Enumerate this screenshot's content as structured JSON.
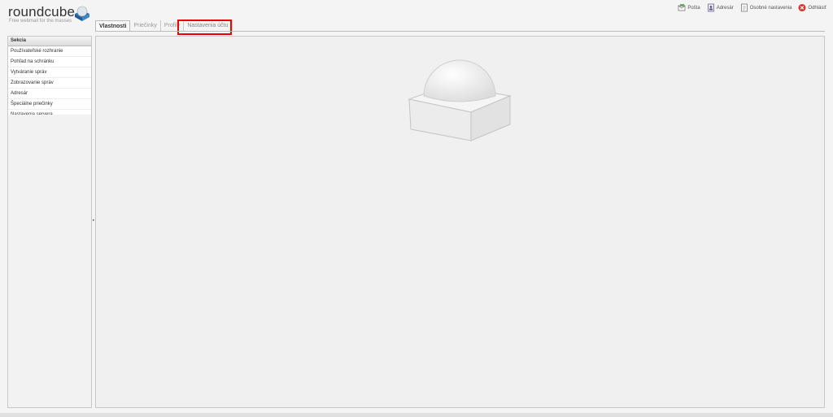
{
  "app": {
    "logo_text": "roundcube",
    "logo_tagline": "Free webmail for the masses"
  },
  "topnav": [
    {
      "label": "Pošta",
      "icon": "mail-icon"
    },
    {
      "label": "Adresár",
      "icon": "address-book-icon"
    },
    {
      "label": "Osobné nastavenia",
      "icon": "settings-document-icon"
    },
    {
      "label": "Odhlásiť",
      "icon": "logout-icon"
    }
  ],
  "tabs": [
    {
      "label": "Vlastnosti",
      "active": true
    },
    {
      "label": "Priečinky",
      "active": false
    },
    {
      "label": "Profily",
      "active": false
    },
    {
      "label": "Nastavenia účtu",
      "active": false
    }
  ],
  "sidebar": {
    "header": "Sekcia",
    "items": [
      "Používateľské rozhranie",
      "Pohľad na schránku",
      "Vytváranie správ",
      "Zobrazovanie správ",
      "Adresár",
      "Špeciálne priečinky",
      "Nastavenia servera"
    ]
  },
  "colors": {
    "highlight": "#e00000",
    "background": "#f4f4f4"
  }
}
